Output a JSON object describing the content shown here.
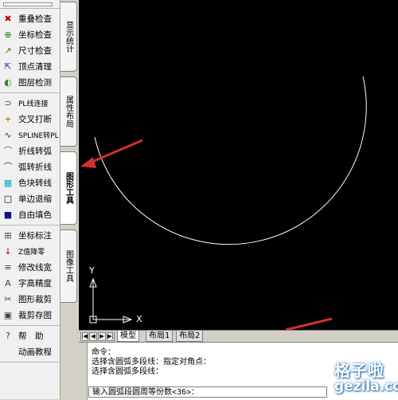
{
  "toolbar_groups": [
    [
      {
        "icon": "overlap-check-icon",
        "glyph": "✖",
        "color": "#c00000",
        "label": "重叠检查"
      },
      {
        "icon": "coordinate-check-icon",
        "glyph": "⊕",
        "color": "#207020",
        "label": "坐标检查"
      },
      {
        "icon": "dimension-check-icon",
        "glyph": "↗",
        "color": "#6a5a20",
        "label": "尺寸检查"
      },
      {
        "icon": "vertex-clean-icon",
        "glyph": "⇱",
        "color": "#1a3a8a",
        "label": "顶点清理"
      },
      {
        "icon": "layer-detect-icon",
        "glyph": "◐",
        "color": "#2a8a2a",
        "label": "图层检测"
      }
    ],
    [
      {
        "icon": "pline-join-icon",
        "glyph": "⊃",
        "color": "#404040",
        "label": "PL线连接",
        "small": true
      },
      {
        "icon": "cross-break-icon",
        "glyph": "+",
        "color": "#b06000",
        "label": "交叉打断"
      },
      {
        "icon": "spline-to-pl-icon",
        "glyph": "∿",
        "color": "#1a3a8a",
        "label": "SPLINE转PL",
        "small": true
      },
      {
        "icon": "polyline-to-arc-icon",
        "glyph": "⌒",
        "color": "#6a5a20",
        "label": "折线转弧"
      },
      {
        "icon": "arc-to-polyline-icon",
        "glyph": "⌒",
        "color": "#404040",
        "label": "弧转折线"
      },
      {
        "icon": "color-block-icon",
        "glyph": "▦",
        "color": "#00b0c0",
        "label": "色块转线"
      },
      {
        "icon": "single-edge-shrink-icon",
        "glyph": "□",
        "color": "#000000",
        "label": "单边退缩"
      },
      {
        "icon": "free-fill-icon",
        "glyph": "■",
        "color": "#10108a",
        "label": "自由填色"
      }
    ],
    [
      {
        "icon": "coordinate-label-icon",
        "glyph": "⊞",
        "color": "#404040",
        "label": "坐标标注"
      },
      {
        "icon": "z-reset-icon",
        "glyph": "↓",
        "color": "#c00000",
        "label": "Z值降零",
        "small": true
      },
      {
        "icon": "line-width-icon",
        "glyph": "≡",
        "color": "#404040",
        "label": "修改线宽"
      },
      {
        "icon": "text-precision-icon",
        "glyph": "A",
        "color": "#404040",
        "label": "字高精度"
      },
      {
        "icon": "clip-figure-icon",
        "glyph": "✂",
        "color": "#404040",
        "label": "图形裁剪"
      },
      {
        "icon": "clip-save-icon",
        "glyph": "▣",
        "color": "#404040",
        "label": "裁剪存图"
      }
    ],
    [
      {
        "icon": "help-icon",
        "glyph": "?",
        "color": "#1a3a8a",
        "label": "帮　助"
      },
      {
        "icon": "animation-tutorial-icon",
        "glyph": "",
        "color": "#404040",
        "label": "动画教程"
      }
    ]
  ],
  "vertical_tabs": [
    {
      "label": "显示统计",
      "active": false
    },
    {
      "label": "属性布局",
      "active": false
    },
    {
      "label": "图形工具",
      "active": true
    },
    {
      "label": "图像工具",
      "active": false
    }
  ],
  "ucs": {
    "x_label": "X",
    "y_label": "Y"
  },
  "layout_tabs": [
    "模型",
    "布局1",
    "布局2"
  ],
  "command_lines": [
    "命令：",
    "选择含圆弧多段线：指定对角点：",
    "选择含圆弧多段线："
  ],
  "command_prompt": "输入圆弧段圆周等份数<36>：",
  "watermark": {
    "line1": "格子啦",
    "line2": "gezila.com"
  }
}
